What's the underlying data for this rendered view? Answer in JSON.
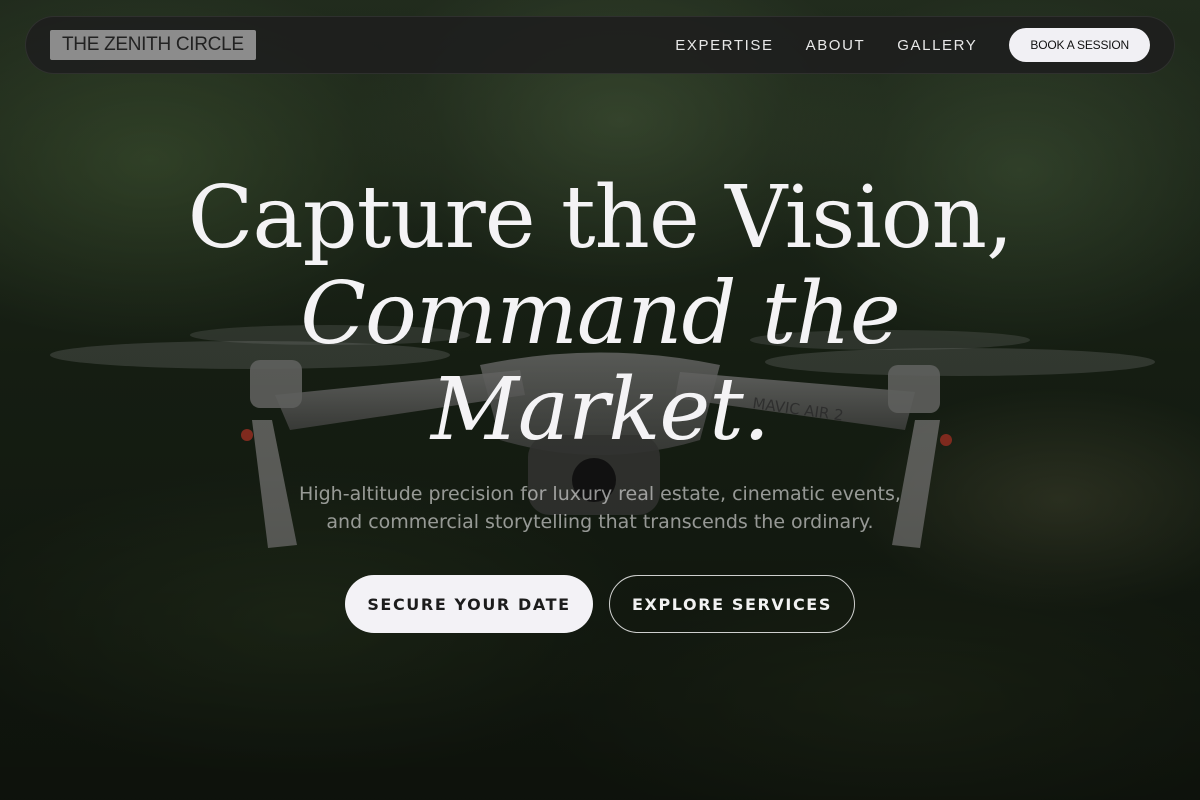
{
  "nav": {
    "brand": "THE ZENITH CIRCLE",
    "links": [
      "EXPERTISE",
      "ABOUT",
      "GALLERY"
    ],
    "cta": "BOOK A SESSION"
  },
  "hero": {
    "headline_line1": "Capture the Vision,",
    "headline_line2": "Command the",
    "headline_line3": "Market.",
    "subtitle": "High-altitude precision for luxury real estate, cinematic events, and commercial storytelling that transcends the ordinary.",
    "primary_button": "SECURE YOUR DATE",
    "secondary_button": "EXPLORE SERVICES"
  },
  "background": {
    "image": "drone",
    "drone_label": "MAVIC AIR 2"
  }
}
